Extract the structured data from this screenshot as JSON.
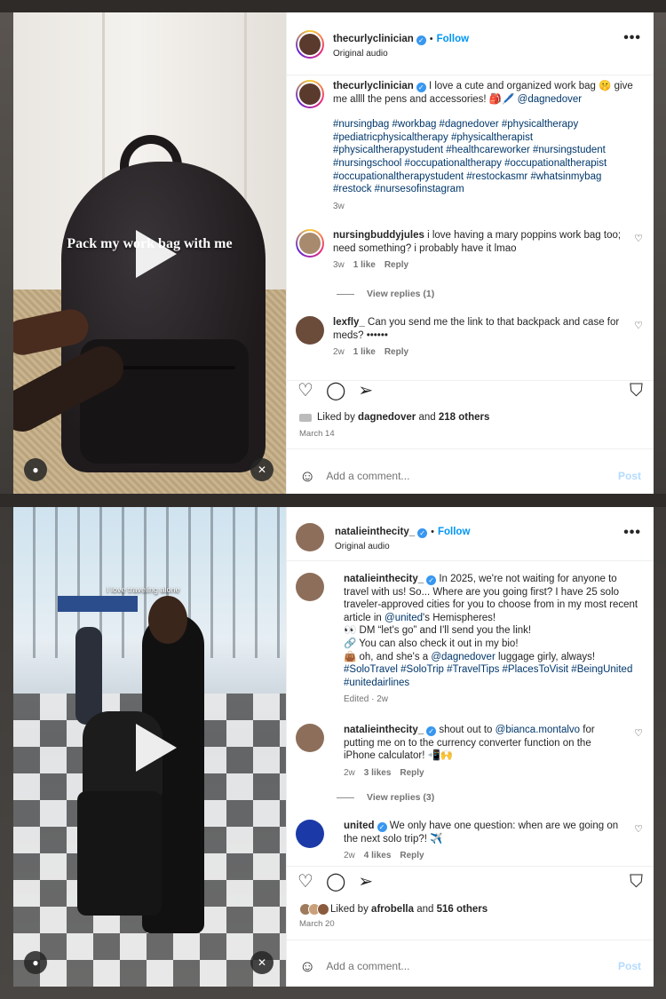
{
  "colors": {
    "accent": "#0095f6",
    "link": "#00376b",
    "muted": "#737373",
    "verified": "#3897f0"
  },
  "posts": [
    {
      "video_overlay": "Pack my work bag with me",
      "header": {
        "username": "thecurlyclinician",
        "follow": "Follow",
        "subline": "Original audio"
      },
      "caption": {
        "username": "thecurlyclinician",
        "text": "I love a cute and organized work bag 🤫 give me allll the pens and accessories! 🎒🖊️",
        "mention": "@dagnedover",
        "hashtags": "#nursingbag #workbag #dagnedover #physicaltherapy #pediatricphysicaltherapy #physicaltherapist #physicaltherapystudent #healthcareworker #nursingstudent #nursingschool #occupationaltherapy #occupationaltherapist #occupationaltherapystudent #restockasmr #whatsinmybag #restock #nursesofinstagram",
        "time": "3w"
      },
      "comments": [
        {
          "username": "nursingbuddyjules",
          "text": "i love having a mary poppins work bag too; need something? i probably have it lmao",
          "time": "3w",
          "likes": "1 like",
          "reply": "Reply",
          "view_replies": "View replies (1)"
        },
        {
          "username": "lexfly_",
          "text": "Can you send me the link to that backpack and case for meds? ••••••",
          "time": "2w",
          "likes": "1 like",
          "reply": "Reply"
        }
      ],
      "liked_by": {
        "prefix": "Liked by",
        "user": "dagnedover",
        "and": "and",
        "others": "218 others"
      },
      "date": "March 14",
      "comment_placeholder": "Add a comment...",
      "post_label": "Post"
    },
    {
      "video_overlay": "I love traveling alone",
      "header": {
        "username": "natalieinthecity_",
        "follow": "Follow",
        "subline": "Original audio"
      },
      "caption": {
        "username": "natalieinthecity_",
        "line1": "In 2025, we're not waiting for anyone to travel with us! So... Where are you going first? I have 25 solo traveler-approved cities for you to choose from in my most recent article in",
        "mention1": "@united",
        "line1b": "'s Hemispheres!",
        "line2": "👀 DM “let's go” and I'll send you the link!",
        "line3": "🔗 You can also check it out in my bio!",
        "line4a": "👜 oh, and she's a",
        "mention2": "@dagnedover",
        "line4b": "luggage girly, always!",
        "hashtags": "#SoloTravel #SoloTrip #TravelTips #PlacesToVisit #BeingUnited #unitedairlines",
        "time": "Edited · 2w"
      },
      "comments": [
        {
          "username": "natalieinthecity_",
          "text_a": "shout out to",
          "mention": "@bianca.montalvo",
          "text_b": "for putting me on to the currency converter function on the iPhone calculator! 📲🙌",
          "time": "2w",
          "likes": "3 likes",
          "reply": "Reply",
          "view_replies": "View replies (3)"
        },
        {
          "username": "united",
          "text": "We only have one question: when are we going on the next solo trip?! ✈️",
          "time": "2w",
          "likes": "4 likes",
          "reply": "Reply"
        }
      ],
      "liked_by": {
        "prefix": "Liked by",
        "user": "afrobella",
        "and": "and",
        "others": "516 others"
      },
      "date": "March 20",
      "comment_placeholder": "Add a comment...",
      "post_label": "Post"
    }
  ],
  "icons": {
    "like": "♡",
    "comment": "◯",
    "share": "➢",
    "save": "⛉",
    "more": "•••",
    "emoji": "☺",
    "user": "●",
    "muted": "✕",
    "heart_small": "♡",
    "verified": "✓"
  }
}
